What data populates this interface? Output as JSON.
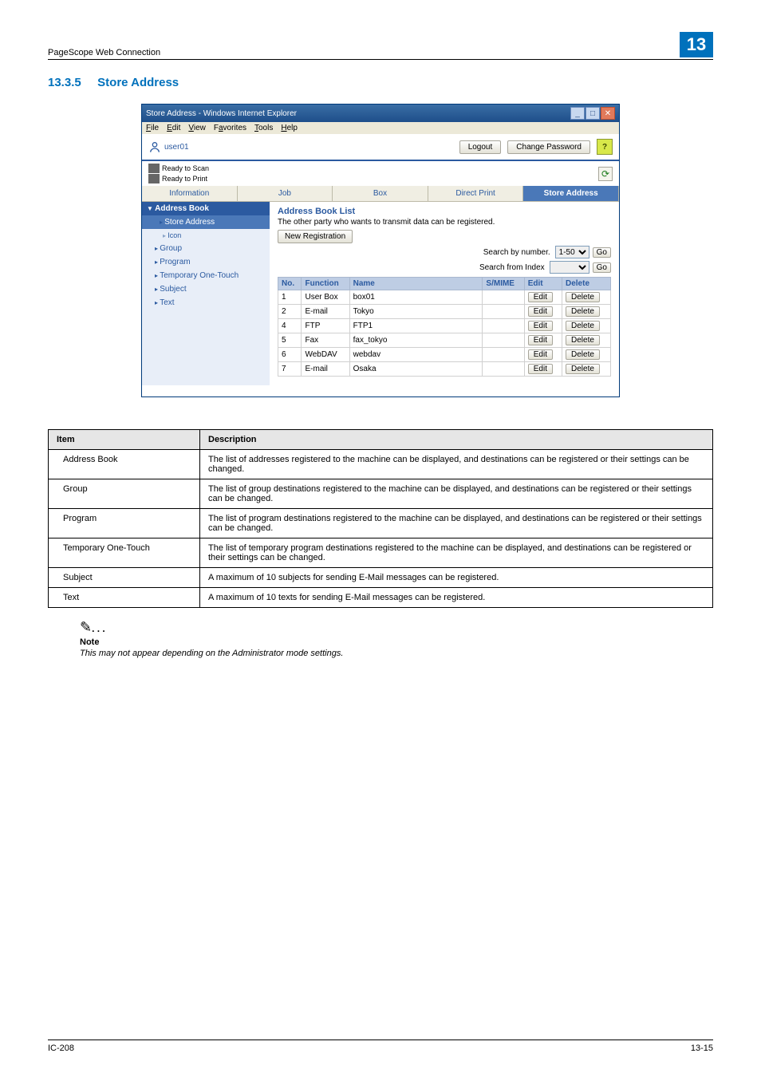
{
  "header": {
    "title": "PageScope Web Connection",
    "badge": "13"
  },
  "section": {
    "number": "13.3.5",
    "title": "Store Address"
  },
  "window": {
    "title": "Store Address - Windows Internet Explorer",
    "menus": {
      "file": "File",
      "edit": "Edit",
      "view": "View",
      "favorites": "Favorites",
      "tools": "Tools",
      "help": "Help"
    },
    "user": "user01",
    "logout": "Logout",
    "change_pwd": "Change Password",
    "help": "?",
    "status1": "Ready to Scan",
    "status2": "Ready to Print",
    "tabs": {
      "information": "Information",
      "job": "Job",
      "box": "Box",
      "direct": "Direct Print",
      "store": "Store Address"
    },
    "sidebar": {
      "address_book": "Address Book",
      "store_address": "Store Address",
      "icon": "Icon",
      "group": "Group",
      "program": "Program",
      "temporary": "Temporary One-Touch",
      "subject": "Subject",
      "text": "Text"
    },
    "main": {
      "heading": "Address Book List",
      "intro": "The other party who wants to transmit data can be registered.",
      "new_reg": "New Registration",
      "search_number_lbl": "Search by number.",
      "search_number_opt": "1-50",
      "search_index_lbl": "Search from Index",
      "go": "Go",
      "columns": {
        "no": "No.",
        "func": "Function",
        "name": "Name",
        "smime": "S/MIME",
        "edit": "Edit",
        "del": "Delete"
      },
      "rows": [
        {
          "no": "1",
          "func": "User Box",
          "name": "box01"
        },
        {
          "no": "2",
          "func": "E-mail",
          "name": "Tokyo"
        },
        {
          "no": "4",
          "func": "FTP",
          "name": "FTP1"
        },
        {
          "no": "5",
          "func": "Fax",
          "name": "fax_tokyo"
        },
        {
          "no": "6",
          "func": "WebDAV",
          "name": "webdav"
        },
        {
          "no": "7",
          "func": "E-mail",
          "name": "Osaka"
        }
      ],
      "edit_btn": "Edit",
      "del_btn": "Delete"
    }
  },
  "desc": {
    "h_item": "Item",
    "h_desc": "Description",
    "rows": [
      {
        "item": "Address Book",
        "desc": "The list of addresses registered to the machine can be displayed, and destinations can be registered or their settings can be changed."
      },
      {
        "item": "Group",
        "desc": "The list of group destinations registered to the machine can be displayed, and destinations can be registered or their settings can be changed."
      },
      {
        "item": "Program",
        "desc": "The list of program destinations registered to the machine can be displayed, and destinations can be registered or their settings can be changed."
      },
      {
        "item": "Temporary One-Touch",
        "desc": "The list of temporary program destinations registered to the machine can be displayed, and destinations can be registered or their settings can be changed."
      },
      {
        "item": "Subject",
        "desc": "A maximum of 10 subjects for sending E-Mail messages can be registered."
      },
      {
        "item": "Text",
        "desc": "A maximum of 10 texts for sending E-Mail messages can be registered."
      }
    ]
  },
  "note": {
    "label": "Note",
    "text": "This may not appear depending on the Administrator mode settings."
  },
  "footer": {
    "left": "IC-208",
    "right": "13-15"
  }
}
